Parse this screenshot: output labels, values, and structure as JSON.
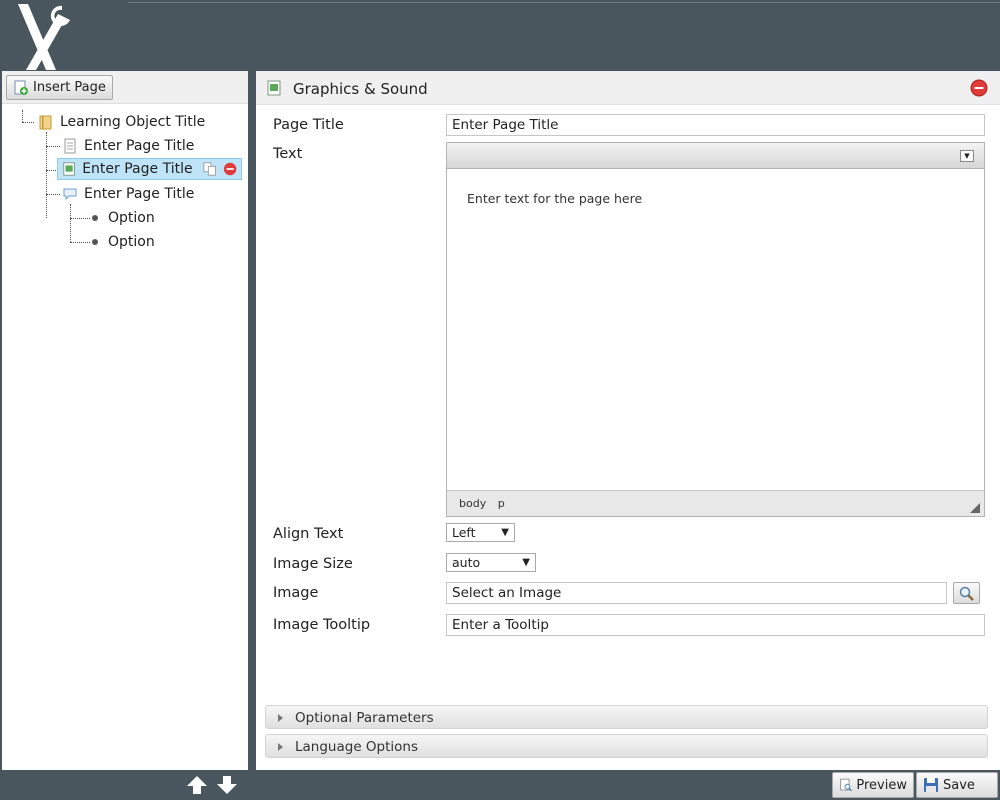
{
  "toolbar": {
    "insert_page_label": "Insert Page"
  },
  "tree": {
    "root": "Learning Object Title",
    "items": [
      {
        "label": "Enter Page Title",
        "type": "text-page"
      },
      {
        "label": "Enter Page Title",
        "type": "graphics-page",
        "selected": true
      },
      {
        "label": "Enter Page Title",
        "type": "quiz-page"
      }
    ],
    "options": [
      "Option",
      "Option"
    ]
  },
  "editor_panel": {
    "title": "Graphics & Sound",
    "fields": {
      "page_title_label": "Page Title",
      "page_title_value": "Enter Page Title",
      "text_label": "Text",
      "text_value": "Enter text for the page here",
      "status_path": [
        "body",
        "p"
      ],
      "align_text_label": "Align Text",
      "align_text_value": "Left",
      "image_size_label": "Image Size",
      "image_size_value": "auto",
      "image_label": "Image",
      "image_value": "Select an Image",
      "image_tooltip_label": "Image Tooltip",
      "image_tooltip_value": "Enter a Tooltip"
    },
    "sections": [
      "Optional Parameters",
      "Language Options"
    ]
  },
  "footer": {
    "preview_label": "Preview",
    "save_label": "Save"
  },
  "colors": {
    "chrome": "#4a565d",
    "selected": "#bfe4f8",
    "delete": "#e03a3a"
  }
}
